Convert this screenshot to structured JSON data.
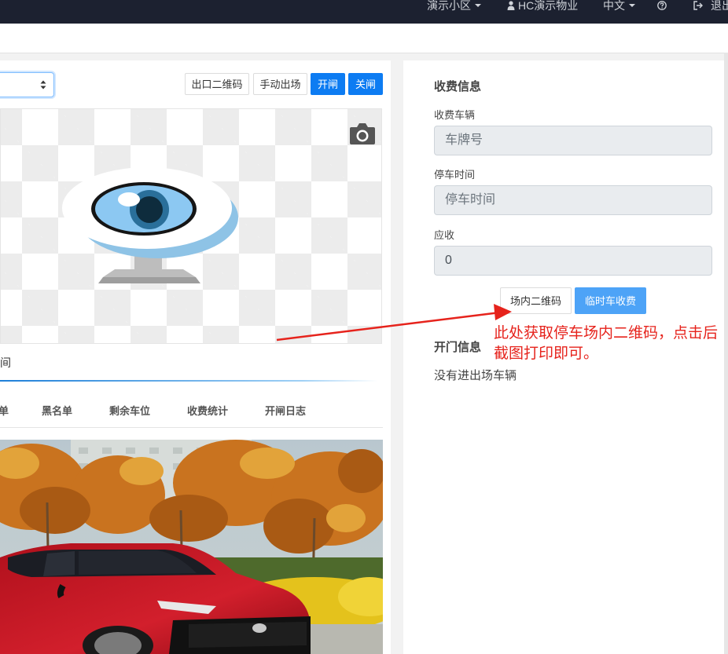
{
  "topbar": {
    "community": "演示小区",
    "company": "HC演示物业",
    "language": "中文",
    "help_icon": "help-icon",
    "logout": "退出"
  },
  "controls": {
    "exit_qr": "出口二维码",
    "manual_exit": "手动出场",
    "open_gate": "开闸",
    "close_gate": "关闸"
  },
  "tabs": {
    "active_fragment": "间",
    "items": [
      "单",
      "黑名单",
      "剩余车位",
      "收费统计",
      "开闸日志"
    ]
  },
  "charge": {
    "title": "收费信息",
    "vehicle_label": "收费车辆",
    "vehicle_placeholder": "车牌号",
    "time_label": "停车时间",
    "time_placeholder": "停车时间",
    "due_label": "应收",
    "due_value": "0",
    "inner_qr": "场内二维码",
    "temp_charge": "临时车收费"
  },
  "gate": {
    "title": "开门信息",
    "empty": "没有进出场车辆"
  },
  "annotation": {
    "text": "此处获取停车场内二维码，点击后截图打印即可。"
  },
  "colors": {
    "topbar": "#1c2130",
    "primary": "#0d7cf2",
    "light_primary": "#4da3f7",
    "annotation": "#e6231c"
  }
}
